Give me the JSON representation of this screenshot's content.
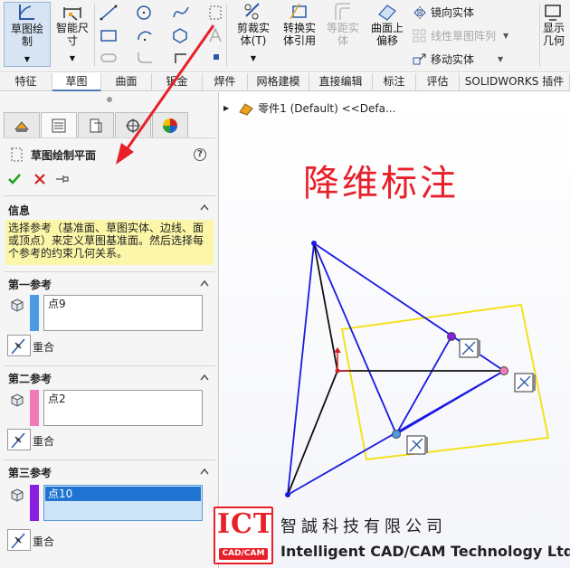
{
  "ribbon": {
    "sketch_label": "草图绘\n制",
    "smart_dim_label": "智能尺\n寸",
    "trim_label": "剪裁实\n体(T)",
    "convert_label": "转换实\n体引用",
    "offset_label": "等距实\n体",
    "surface_offset_label": "曲面上\n偏移",
    "mirror_label": "镜向实体",
    "linear_pattern_label": "线性草图阵列",
    "move_label": "移动实体",
    "display_label": "显示\n几何"
  },
  "tabs": [
    "特征",
    "草图",
    "曲面",
    "钣金",
    "焊件",
    "网格建模",
    "直接编辑",
    "标注",
    "评估",
    "SOLIDWORKS 插件"
  ],
  "panel": {
    "title": "草图绘制平面",
    "help_glyph": "?",
    "info_header": "信息",
    "info_text": "选择参考（基准面、草图实体、边线、面或顶点）来定义草图基准面。然后选择每个参考的约束几何关系。",
    "refs": [
      {
        "header": "第一参考",
        "item": "点9",
        "color": "#4a9ae6",
        "relation": "重合"
      },
      {
        "header": "第二参考",
        "item": "点2",
        "color": "#f07ab8",
        "relation": "重合"
      },
      {
        "header": "第三参考",
        "item": "点10",
        "color": "#8a1ee0",
        "relation": "重合"
      }
    ]
  },
  "graphics": {
    "breadcrumb": "零件1 (Default) <<Defa...",
    "caption": "降维标注"
  },
  "watermark": {
    "logo_top": "ICT",
    "logo_bottom": "CAD/CAM",
    "company_cn": "智誠科技有限公司",
    "company_en": "Intelligent CAD/CAM Technology Ltd."
  },
  "colors": {
    "accent": "#2a5aa8",
    "sketch_blue": "#1a1ae0",
    "annotation_red": "#e8202a",
    "plane_yellow": "#f2e21c"
  }
}
